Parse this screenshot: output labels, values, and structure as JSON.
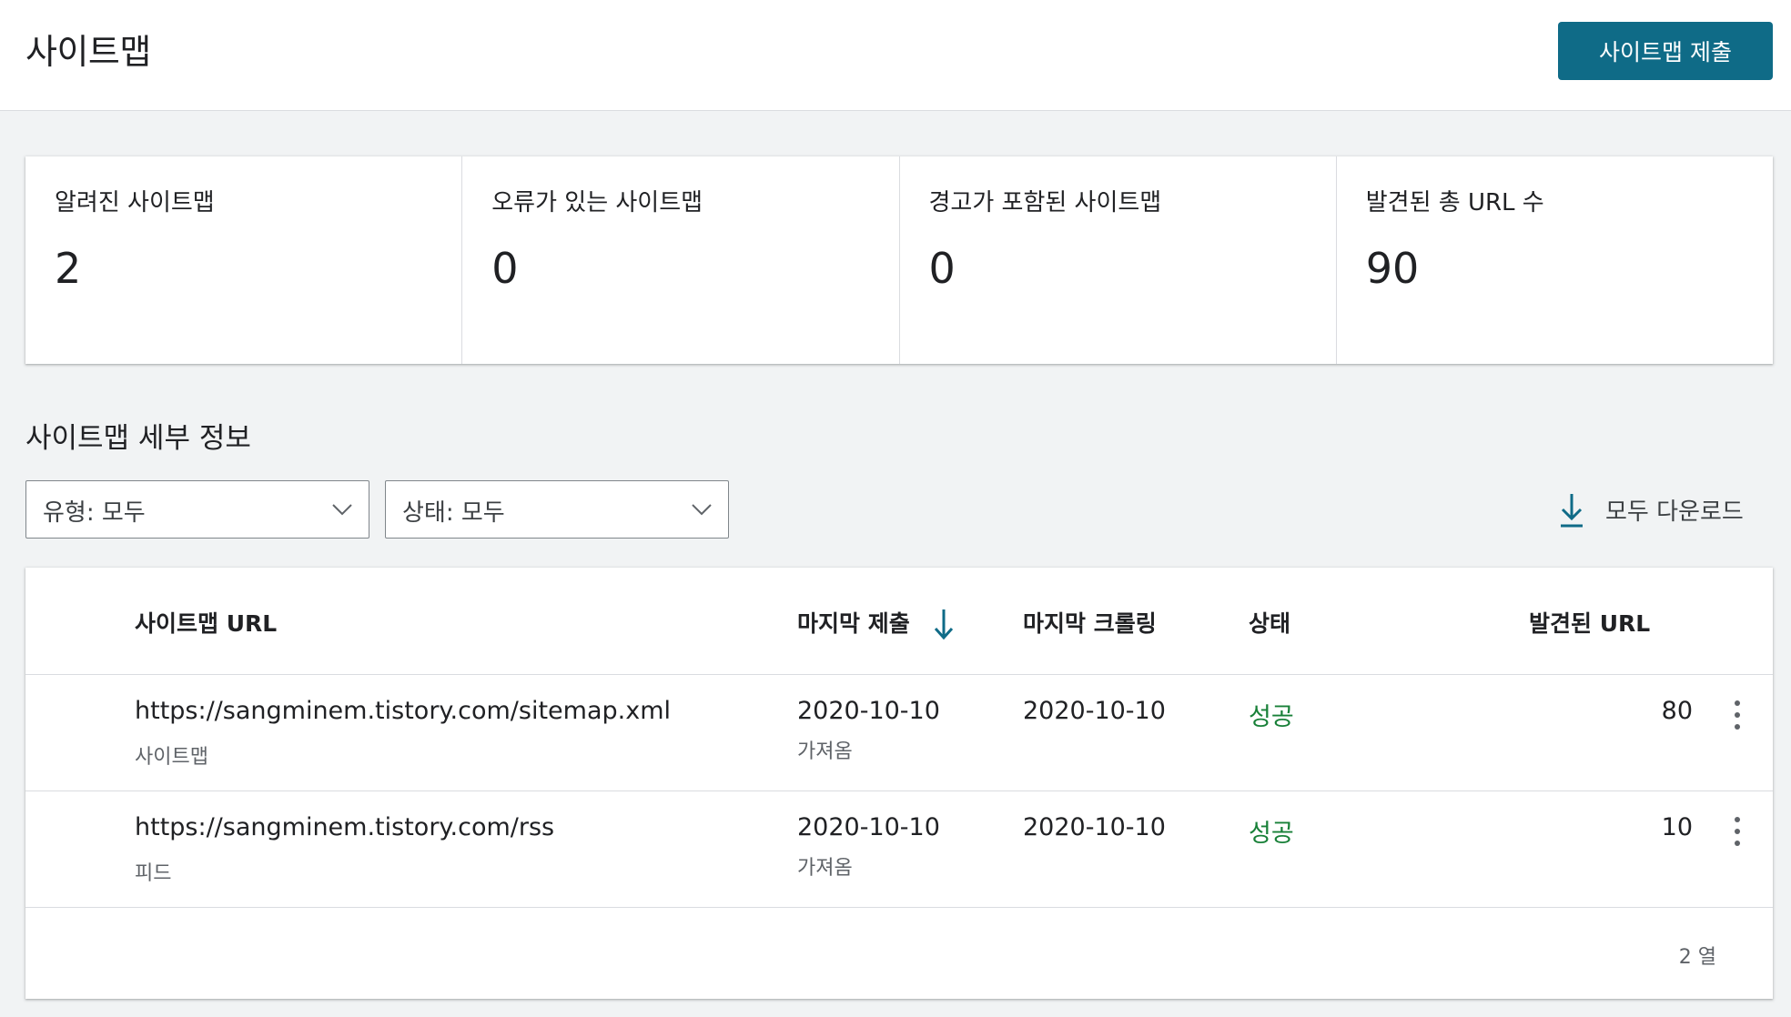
{
  "header": {
    "title": "사이트맵",
    "submit_label": "사이트맵 제출"
  },
  "summary": [
    {
      "label": "알려진 사이트맵",
      "value": "2"
    },
    {
      "label": "오류가 있는 사이트맵",
      "value": "0"
    },
    {
      "label": "경고가 포함된 사이트맵",
      "value": "0"
    },
    {
      "label": "발견된 총 URL 수",
      "value": "90"
    }
  ],
  "details": {
    "title": "사이트맵 세부 정보",
    "filters": [
      {
        "label": "유형: 모두"
      },
      {
        "label": "상태: 모두"
      }
    ],
    "download_label": "모두 다운로드"
  },
  "table": {
    "columns": {
      "url": "사이트맵 URL",
      "last_submitted": "마지막 제출",
      "last_crawled": "마지막 크롤링",
      "status": "상태",
      "discovered": "발견된 URL"
    },
    "rows": [
      {
        "url": "https://sangminem.tistory.com/sitemap.xml",
        "type": "사이트맵",
        "submitted": "2020-10-10",
        "submitted_sub": "가져옴",
        "crawled": "2020-10-10",
        "status": "성공",
        "discovered": "80"
      },
      {
        "url": "https://sangminem.tistory.com/rss",
        "type": "피드",
        "submitted": "2020-10-10",
        "submitted_sub": "가져옴",
        "crawled": "2020-10-10",
        "status": "성공",
        "discovered": "10"
      }
    ],
    "row_count": "2 열"
  },
  "colors": {
    "accent": "#0f6b87",
    "success": "#188038",
    "background": "#f1f3f4"
  },
  "icons": [
    "chevron-down-icon",
    "download-icon",
    "sort-arrow-down-icon",
    "more-vert-icon"
  ]
}
